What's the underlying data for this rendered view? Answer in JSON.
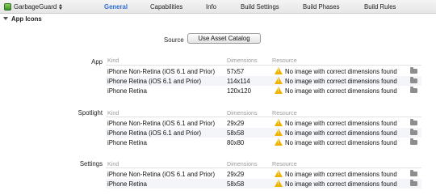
{
  "target": {
    "name": "GarbageGuard"
  },
  "tabs": [
    "General",
    "Capabilities",
    "Info",
    "Build Settings",
    "Build Phases",
    "Build Rules"
  ],
  "section": {
    "title": "App Icons"
  },
  "source": {
    "label": "Source",
    "button": "Use Asset Catalog"
  },
  "columns": {
    "kind": "Kind",
    "dimensions": "Dimensions",
    "resource": "Resource"
  },
  "groups": [
    {
      "label": "App",
      "rows": [
        {
          "kind": "iPhone Non-Retina (iOS 6.1 and Prior)",
          "dimensions": "57x57",
          "resource": "No image with correct dimensions found"
        },
        {
          "kind": "iPhone Retina (iOS 6.1 and Prior)",
          "dimensions": "114x114",
          "resource": "No image with correct dimensions found"
        },
        {
          "kind": "iPhone Retina",
          "dimensions": "120x120",
          "resource": "No image with correct dimensions found"
        }
      ]
    },
    {
      "label": "Spotlight",
      "rows": [
        {
          "kind": "iPhone Non-Retina (iOS 6.1 and Prior)",
          "dimensions": "29x29",
          "resource": "No image with correct dimensions found"
        },
        {
          "kind": "iPhone Retina (iOS 6.1 and Prior)",
          "dimensions": "58x58",
          "resource": "No image with correct dimensions found"
        },
        {
          "kind": "iPhone Retina",
          "dimensions": "80x80",
          "resource": "No image with correct dimensions found"
        }
      ]
    },
    {
      "label": "Settings",
      "rows": [
        {
          "kind": "iPhone Non-Retina (iOS 6.1 and Prior)",
          "dimensions": "29x29",
          "resource": "No image with correct dimensions found"
        },
        {
          "kind": "iPhone Retina",
          "dimensions": "58x58",
          "resource": "No image with correct dimensions found"
        }
      ]
    }
  ]
}
